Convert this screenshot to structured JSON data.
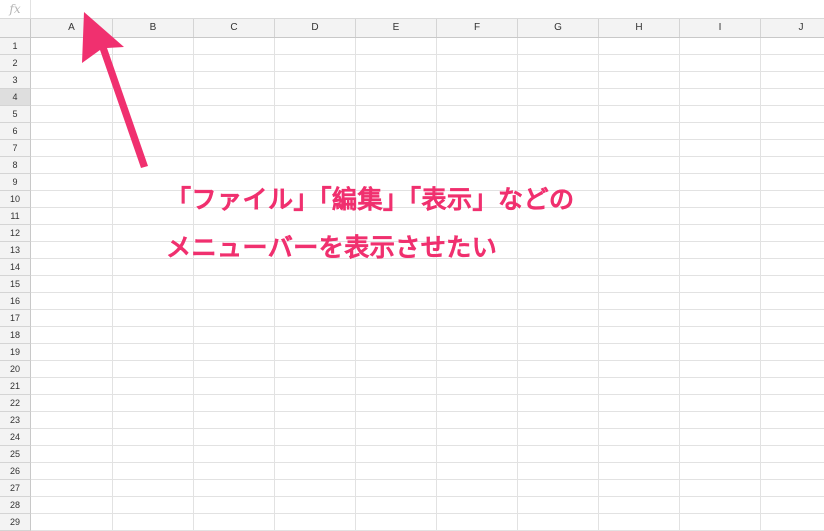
{
  "formula_bar": {
    "fx_label": "fx",
    "value": ""
  },
  "columns": [
    "A",
    "B",
    "C",
    "D",
    "E",
    "F",
    "G",
    "H",
    "I",
    "J"
  ],
  "rows": [
    "1",
    "2",
    "3",
    "4",
    "5",
    "6",
    "7",
    "8",
    "9",
    "10",
    "11",
    "12",
    "13",
    "14",
    "15",
    "16",
    "17",
    "18",
    "19",
    "20",
    "21",
    "22",
    "23",
    "24",
    "25",
    "26",
    "27",
    "28",
    "29"
  ],
  "selected_row": "4",
  "annotation": {
    "line1": "「ファイル」「編集」「表示」などの",
    "line2": "メニューバーを表示させたい",
    "color": "#f0306f"
  },
  "colors": {
    "header_bg": "#f3f3f3",
    "selected_row_bg": "#dedede",
    "grid_line": "#e2e2e2"
  }
}
